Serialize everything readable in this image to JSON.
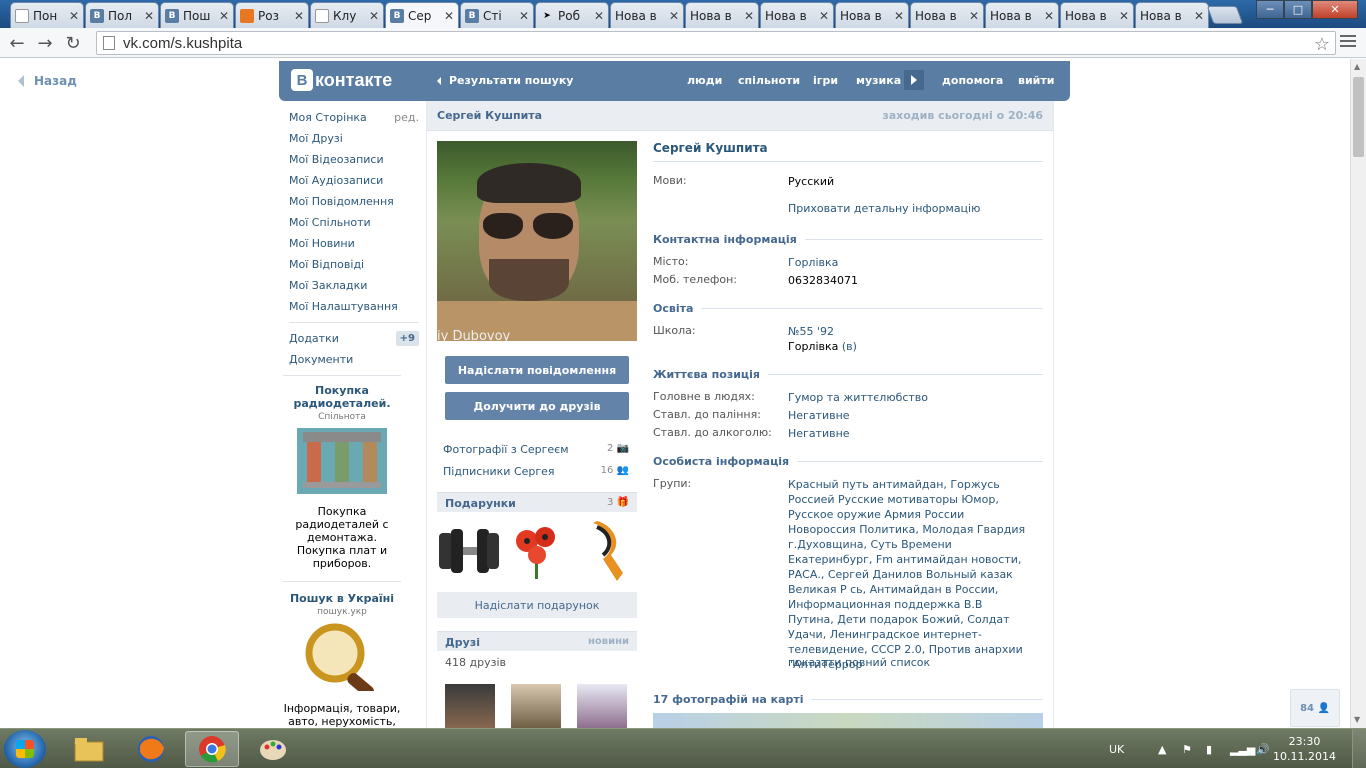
{
  "browser": {
    "tabs": [
      {
        "title": "Пон",
        "icon": "doc-icon",
        "color": "#ffffff"
      },
      {
        "title": "Пол",
        "icon": "vk-icon",
        "color": "#597da3"
      },
      {
        "title": "Пош",
        "icon": "vk-icon",
        "color": "#597da3"
      },
      {
        "title": "Роз",
        "icon": "blogger-icon",
        "color": "#e87722"
      },
      {
        "title": "Клу",
        "icon": "doc-icon",
        "color": "#ffffff"
      },
      {
        "title": "Сер",
        "icon": "vk-icon",
        "color": "#597da3",
        "active": true
      },
      {
        "title": "Сті",
        "icon": "vk-icon",
        "color": "#597da3"
      },
      {
        "title": "Роб",
        "icon": "cursor-icon",
        "color": "#ffffff"
      },
      {
        "title": "Нова в",
        "icon": "",
        "color": ""
      },
      {
        "title": "Нова в",
        "icon": "",
        "color": ""
      },
      {
        "title": "Нова в",
        "icon": "",
        "color": ""
      },
      {
        "title": "Нова в",
        "icon": "",
        "color": ""
      },
      {
        "title": "Нова в",
        "icon": "",
        "color": ""
      },
      {
        "title": "Нова в",
        "icon": "",
        "color": ""
      },
      {
        "title": "Нова в",
        "icon": "",
        "color": ""
      },
      {
        "title": "Нова в",
        "icon": "",
        "color": ""
      }
    ],
    "tab_close": "✕",
    "url": "vk.com/s.kushpita",
    "win_min": "─",
    "win_max": "□",
    "win_close": "✕"
  },
  "page": {
    "back_label": "Назад",
    "logo_text": "контакте",
    "logo_letter": "В",
    "search_results": "Результати пошуку",
    "topnav": [
      "люди",
      "спільноти",
      "ігри",
      "музика",
      "допомога",
      "вийти"
    ],
    "sidenav": {
      "items": [
        "Моя Сторінка",
        "Мої Друзі",
        "Мої Відеозаписи",
        "Мої Аудіозаписи",
        "Мої Повідомлення",
        "Мої Спільноти",
        "Мої Новини",
        "Мої Відповіді",
        "Мої Закладки",
        "Мої Налаштування"
      ],
      "edit": "ред.",
      "apps": "Додатки",
      "apps_count": "+9",
      "docs": "Документи"
    },
    "ads": [
      {
        "title": "Покупка радиодеталей.",
        "sub": "Спільнота",
        "desc": "Покупка радиодеталей с демонтажа. Покупка плат и приборов."
      },
      {
        "title": "Пошук в Україні",
        "sub": "пошук.укр",
        "desc": "Інформація, товари, авто, нерухомість,"
      }
    ],
    "header_name": "Сергей Кушпита",
    "header_online": "заходив сьогодні о 20:46",
    "photo_watermark": "iy Dubovoy",
    "send_message": "Надіслати повідомлення",
    "add_friend": "Долучити до друзів",
    "photos_with": {
      "label": "Фотографії з Сергеєм",
      "count": "2"
    },
    "followers": {
      "label": "Підписники Сергея",
      "count": "16"
    },
    "gifts": {
      "label": "Подарунки",
      "count": "3",
      "send": "Надіслати подарунок"
    },
    "friends": {
      "label": "Друзі",
      "link": "новини",
      "count": "418 друзів"
    },
    "profile": {
      "name": "Сергей Кушпита",
      "languages_label": "Мови:",
      "languages": "Русский",
      "hide_details": "Приховати детальну інформацію",
      "contact_title": "Контактна інформація",
      "city_label": "Місто:",
      "city": "Горлівка",
      "phone_label": "Моб. телефон:",
      "phone": "0632834071",
      "edu_title": "Освіта",
      "school_label": "Школа:",
      "school": "№55 '92",
      "school_city": "Горлівка",
      "school_city_suffix": "(в)",
      "life_title": "Життєва позиція",
      "main_label": "Головне в людях:",
      "main": "Гумор та життєлюбство",
      "smoke_label": "Ставл. до паління:",
      "smoke": "Негативне",
      "alcohol_label": "Ставл. до алкоголю:",
      "alcohol": "Негативне",
      "personal_title": "Особиста інформація",
      "groups_label": "Групи:",
      "groups": "Красный путь антимайдан, Горжусь Россией Русские мотиваторы Юмор, Русское оружие Армия России Новороссия Политика, Молодая Гвардия г.Духовщина, Суть Времени Екатеринбург, Fm антимайдан новости, РАСА., Сергей Данилов Вольный казак Великая Р сь, Антимайдан в России, Информационная поддержка В.В Путина, Дети подарок Божий, Солдат Удачи, Ленинградское интернет-телевидение, СССР 2.0, Против анархии \"АнтиТеррор",
      "show_full": "показати повний список",
      "map_title": "17 фотографій на карті"
    },
    "online_count": "84"
  },
  "taskbar": {
    "lang": "UK",
    "time": "23:30",
    "date": "10.11.2014"
  },
  "colors": {
    "vk_blue": "#597da3",
    "link": "#2b587a"
  }
}
